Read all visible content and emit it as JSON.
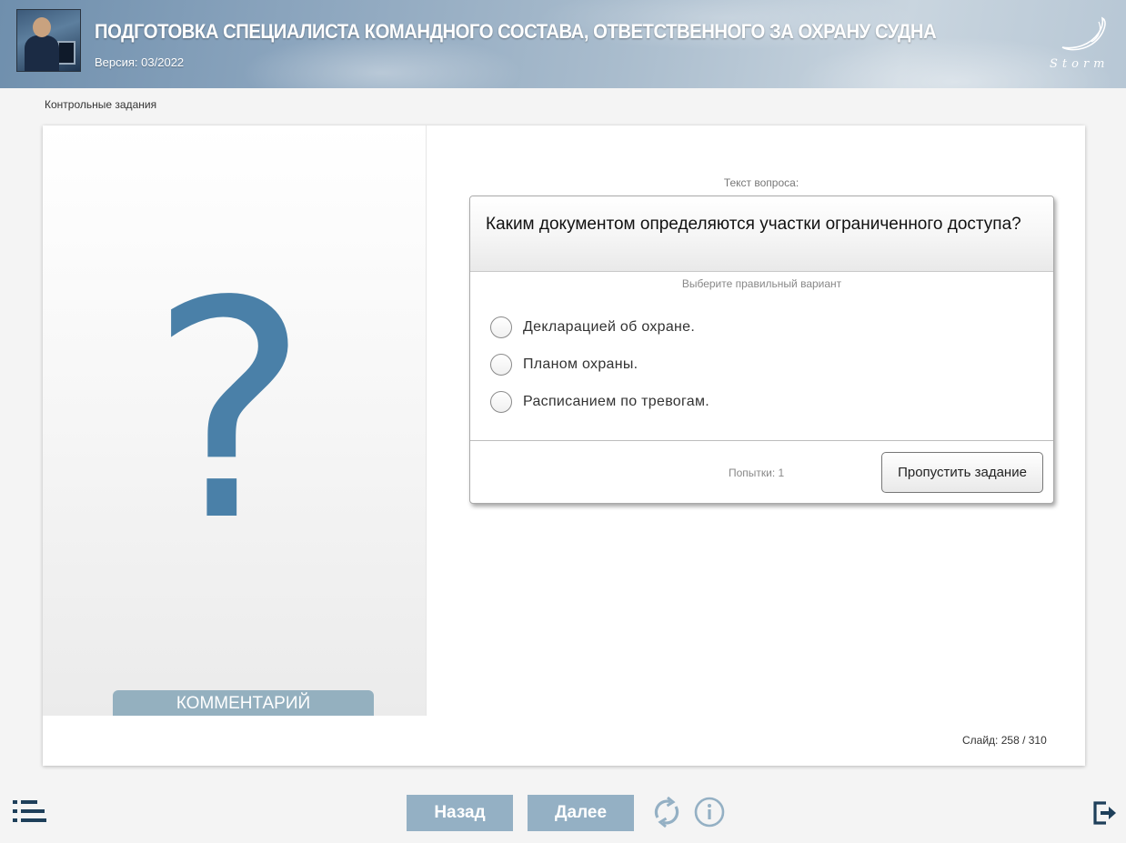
{
  "header": {
    "title": "ПОДГОТОВКА СПЕЦИАЛИСТА КОМАНДНОГО СОСТАВА, ОТВЕТСТВЕННОГО ЗА ОХРАНУ СУДНА",
    "version": "Версия: 03/2022",
    "logo_text": "Storm"
  },
  "breadcrumb": "Контрольные задания",
  "left_panel": {
    "symbol": "?",
    "comment_tab": "КОММЕНТАРИЙ"
  },
  "question": {
    "caption": "Текст вопроса:",
    "text": "Каким документом определяются участки ограниченного доступа?",
    "hint": "Выберите правильный вариант",
    "options": [
      "Декларацией об охране.",
      "Планом охраны.",
      "Расписанием по тревогам."
    ],
    "attempts": "Попытки: 1",
    "skip_label": "Пропустить задание"
  },
  "slide_counter": "Слайд:  258 / 310",
  "toolbar": {
    "back_label": "Назад",
    "next_label": "Далее",
    "menu_icon": "list-menu-icon",
    "reload_icon": "reload-icon",
    "info_icon": "info-icon",
    "exit_icon": "exit-icon"
  },
  "colors": {
    "accent": "#4a80a8",
    "nav_button": "#94b0c4",
    "icon_dark": "#1e3f5a"
  }
}
